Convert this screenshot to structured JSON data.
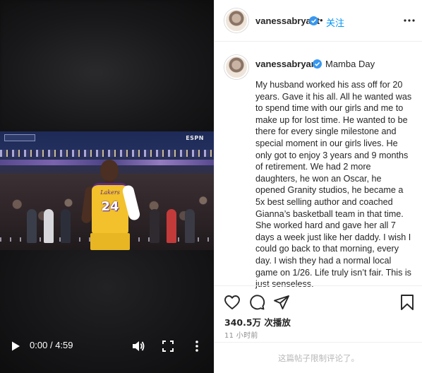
{
  "video": {
    "current_time": "0:00",
    "separator": "/",
    "duration": "4:59",
    "broadcast_logo": "ESPN",
    "jersey_number": "24",
    "jersey_script": "Lakers",
    "state": "paused"
  },
  "header": {
    "username": "vanessabryant",
    "verified": true,
    "dot": "•",
    "follow_label": "关注"
  },
  "caption": {
    "username": "vanessabryant",
    "verified": true,
    "location": "Mamba Day",
    "text": "My husband worked his ass off for 20 years. Gave it his all. All he wanted was to spend time with our girls and me to make up for lost time. He wanted to be there for every single milestone and special moment in our girls lives. He only got to enjoy 3 years and 9 months of retirement. We had 2 more daughters, he won an Oscar, he opened Granity studios, he became a 5x best selling author and coached Gianna’s basketball team in that time. She worked hard and gave her all 7 days a week just like her daddy. I wish I could go back to that morning, every day. I wish they had a normal local game on 1/26. Life truly isn’t fair. This is just senseless."
  },
  "actions": {
    "icons": [
      "heart-icon",
      "comment-icon",
      "share-icon",
      "bookmark-icon"
    ],
    "views": "340.5万 次播放",
    "time_ago": "11 小时前"
  },
  "comments": {
    "notice": "这篇帖子限制评论了。"
  },
  "colors": {
    "link_blue": "#0095f6",
    "verified_blue": "#3897f0",
    "muted_gray": "#8e8e8e"
  }
}
